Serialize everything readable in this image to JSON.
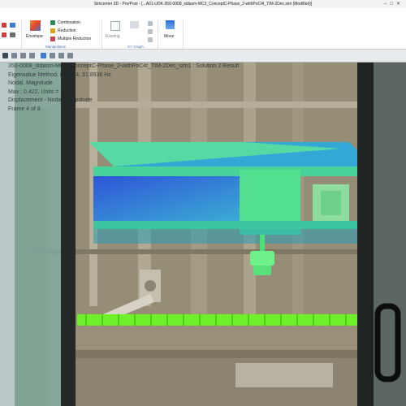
{
  "window": {
    "title": "Simcenter 3D - Pre/Post - [...A01-UDK-350-0008_sldasm-MC3_ConceptC-Phase_2-withPoC4t_TIM-2Dec.sim (Modified)]"
  },
  "ribbon": {
    "envelope_label": "Envelope",
    "combination_label": "Combination",
    "reduction_label": "Reduction",
    "multiple_reduction_label": "Multiple Reduction",
    "manipulation_group": "Manipulation",
    "existing_label": "Existing",
    "xy_graph_group": "XY Graph",
    "move_label": "Move"
  },
  "result_header": {
    "line1": "350-0008_sldasm-MC3_ConceptC-Phase_2-withPoC4t_TIM-2Dec_sim1 : Solution 2 Result",
    "line2": "Eigenvalue Method, Mode 4, 31.8936 Hz",
    "line3": "Nodal, Magnitude",
    "line4": "Max : 0.422, Units = mm",
    "line5": "Displacement - Nodal, Magnitude",
    "line6": "Frame 4 of 8"
  },
  "colors": {
    "ribbon_accent": "#4a72b0",
    "result_low": "#2f55d8",
    "result_mid": "#3fe08c",
    "result_high": "#6ef02a",
    "frame_dark": "#202323"
  }
}
